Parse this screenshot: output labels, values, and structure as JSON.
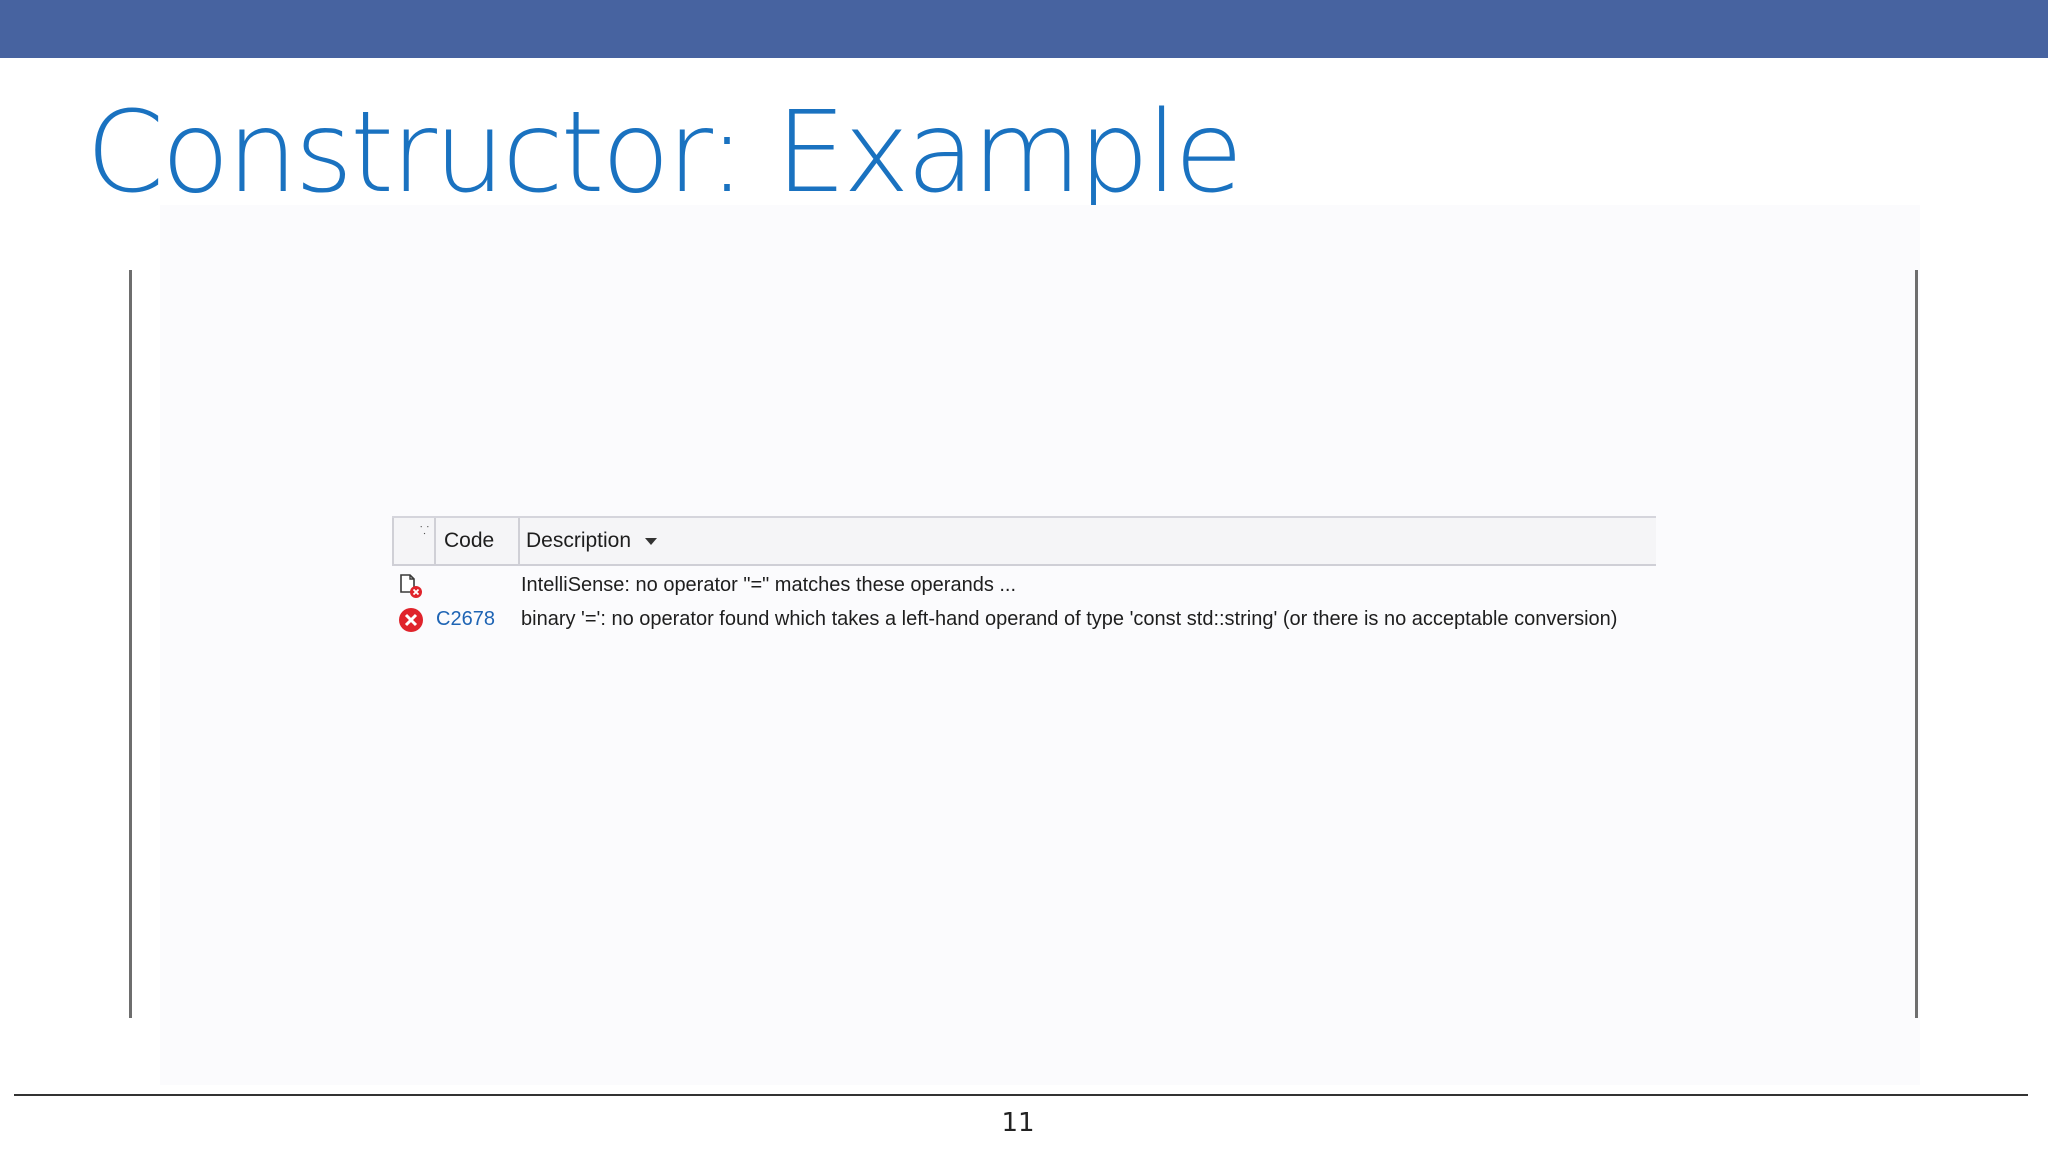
{
  "slide": {
    "title": "Constructor: Example",
    "page_number": "11"
  },
  "error_list": {
    "columns": {
      "code": "Code",
      "description": "Description"
    },
    "rows": [
      {
        "icon": "intellisense-error-icon",
        "code": "",
        "description": "IntelliSense: no operator \"=\" matches these operands ..."
      },
      {
        "icon": "error-circle-icon",
        "code": "C2678",
        "description": "binary '=': no operator found which takes a left-hand operand of type 'const std::string' (or there is no acceptable conversion)"
      }
    ]
  },
  "colors": {
    "top_bar": "#4763a0",
    "title": "#1a72c0",
    "error_red": "#e0232b",
    "code_link": "#1e64b4"
  }
}
